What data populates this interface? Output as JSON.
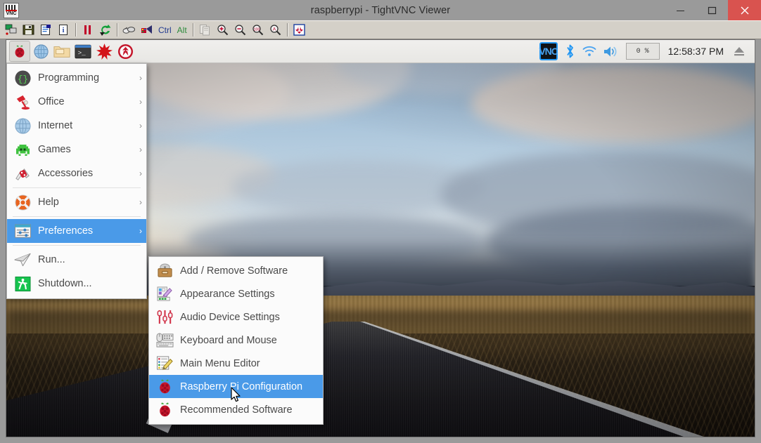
{
  "window": {
    "title": "raspberrypi - TightVNC Viewer",
    "app_icon": "vnc-logo-icon",
    "controls": {
      "minimize": "minimize-button",
      "maximize": "maximize-button",
      "close": "close-button"
    },
    "close_color": "#d9534f"
  },
  "toolbar": {
    "buttons": [
      {
        "name": "new-connection-icon",
        "label": "New connection"
      },
      {
        "name": "save-session-icon",
        "label": "Save session"
      },
      {
        "name": "connection-options-icon",
        "label": "Connection options"
      },
      {
        "name": "connection-info-icon",
        "label": "Connection info"
      },
      {
        "name": "pause-icon",
        "label": "Pause updates"
      },
      {
        "name": "refresh-icon",
        "label": "Refresh screen"
      },
      {
        "name": "send-ctrl-alt-del-icon",
        "label": "Send Ctrl-Alt-Del"
      },
      {
        "name": "send-key-icon",
        "label": "Send key"
      },
      {
        "name": "ctrl-key-text",
        "label": "Ctrl"
      },
      {
        "name": "alt-key-text",
        "label": "Alt"
      },
      {
        "name": "clipboard-transfer-icon",
        "label": "Transfer clipboard"
      },
      {
        "name": "zoom-in-icon",
        "label": "Zoom in"
      },
      {
        "name": "zoom-out-icon",
        "label": "Zoom out"
      },
      {
        "name": "zoom-100-icon",
        "label": "Zoom 100%"
      },
      {
        "name": "zoom-auto-icon",
        "label": "Auto zoom"
      },
      {
        "name": "fullscreen-icon",
        "label": "Full screen"
      }
    ],
    "ctrl_label": "Ctrl",
    "alt_label": "Alt",
    "ctrl_color": "#213a8f",
    "alt_color": "#2e8b3d"
  },
  "rpi_taskbar": {
    "launchers": [
      {
        "name": "raspberry-menu-button",
        "label": "Menu"
      },
      {
        "name": "web-browser-launcher",
        "label": "Web Browser"
      },
      {
        "name": "file-manager-launcher",
        "label": "File Manager"
      },
      {
        "name": "terminal-launcher",
        "label": "Terminal"
      },
      {
        "name": "mathematica-launcher",
        "label": "Mathematica"
      },
      {
        "name": "wolfram-launcher",
        "label": "Wolfram"
      }
    ],
    "tray": {
      "vnc_label": "VNC",
      "bluetooth": "bluetooth-icon",
      "wifi": "wifi-icon",
      "volume": "volume-icon",
      "cpu_usage": "0 %",
      "clock": "12:58:37 PM",
      "eject": "eject-icon"
    },
    "accent": "#4a9ae8"
  },
  "main_menu": {
    "items": [
      {
        "label": "Programming",
        "icon": "programming-braces-icon",
        "arrow": "›",
        "selected": false
      },
      {
        "label": "Office",
        "icon": "office-lamp-icon",
        "arrow": "›",
        "selected": false
      },
      {
        "label": "Internet",
        "icon": "internet-globe-icon",
        "arrow": "›",
        "selected": false
      },
      {
        "label": "Games",
        "icon": "games-invader-icon",
        "arrow": "›",
        "selected": false
      },
      {
        "label": "Accessories",
        "icon": "accessories-knife-icon",
        "arrow": "›",
        "selected": false
      },
      {
        "label": "Help",
        "icon": "help-lifebuoy-icon",
        "arrow": "›",
        "selected": false
      },
      {
        "label": "Preferences",
        "icon": "preferences-sliders-icon",
        "arrow": "›",
        "selected": true
      },
      {
        "label": "Run...",
        "icon": "run-paperplane-icon",
        "arrow": "",
        "selected": false
      },
      {
        "label": "Shutdown...",
        "icon": "shutdown-exit-icon",
        "arrow": "",
        "selected": false
      }
    ]
  },
  "preferences_submenu": {
    "items": [
      {
        "label": "Add / Remove Software",
        "icon": "add-remove-software-icon",
        "selected": false
      },
      {
        "label": "Appearance Settings",
        "icon": "appearance-settings-icon",
        "selected": false
      },
      {
        "label": "Audio Device Settings",
        "icon": "audio-device-icon",
        "selected": false
      },
      {
        "label": "Keyboard and Mouse",
        "icon": "keyboard-mouse-icon",
        "selected": false
      },
      {
        "label": "Main Menu Editor",
        "icon": "main-menu-editor-icon",
        "selected": false
      },
      {
        "label": "Raspberry Pi Configuration",
        "icon": "raspberry-pi-config-icon",
        "selected": true
      },
      {
        "label": "Recommended Software",
        "icon": "recommended-software-icon",
        "selected": false
      }
    ]
  },
  "desktop": {
    "wallpaper": "road-at-dusk-photo",
    "cursor": "mouse-pointer"
  },
  "colors": {
    "menu_highlight": "#4a9ae8",
    "menu_bg": "#fbfbfb",
    "menu_text": "#4a4a4a",
    "taskbar_bg": "#ececea",
    "window_chrome": "#9a9a9a",
    "toolbar_bg": "#d4d0c8"
  }
}
